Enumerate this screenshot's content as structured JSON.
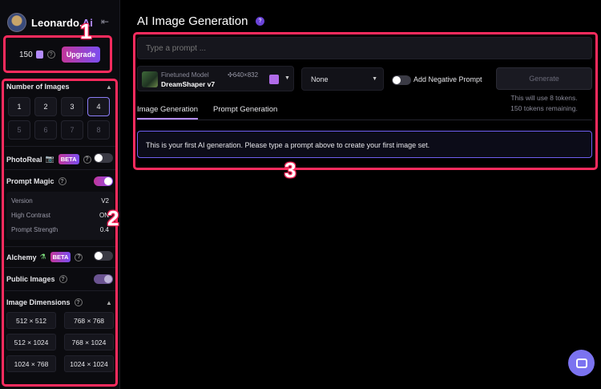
{
  "sidebar": {
    "brand_name": "Leonardo.",
    "brand_ai": "Ai",
    "collapse_icon": "collapse-icon",
    "tokens": {
      "count": "150",
      "upgrade_label": "Upgrade"
    },
    "number_of_images": {
      "label": "Number of Images",
      "options": [
        "1",
        "2",
        "3",
        "4",
        "5",
        "6",
        "7",
        "8"
      ],
      "selected": "4"
    },
    "photoreal": {
      "label": "PhotoReal",
      "badge": "BETA",
      "enabled": false
    },
    "prompt_magic": {
      "label": "Prompt Magic",
      "enabled": true,
      "version_label": "Version",
      "version_value": "V2",
      "high_contrast_label": "High Contrast",
      "high_contrast_value": "ON",
      "prompt_strength_label": "Prompt Strength",
      "prompt_strength_value": "0.4"
    },
    "alchemy": {
      "label": "Alchemy",
      "badge": "BETA",
      "enabled": false
    },
    "public_images": {
      "label": "Public Images",
      "enabled": true
    },
    "image_dimensions": {
      "label": "Image Dimensions",
      "options": [
        "512 × 512",
        "768 × 768",
        "512 × 1024",
        "768 × 1024",
        "1024 × 768",
        "1024 × 1024"
      ]
    }
  },
  "main": {
    "title": "AI Image Generation",
    "prompt_placeholder": "Type a prompt ...",
    "model": {
      "sub_label": "Finetuned Model",
      "resolution": "640×832",
      "name": "DreamShaper v7"
    },
    "style_select": "None",
    "negative_prompt_label": "Add Negative Prompt",
    "generate_label": "Generate",
    "token_note_1": "This will use 8 tokens.",
    "token_note_2": "150 tokens remaining.",
    "tabs": [
      {
        "label": "Image Generation",
        "active": true
      },
      {
        "label": "Prompt Generation",
        "active": false
      }
    ],
    "notice": "This is your first AI generation. Please type a prompt above to create your first image set."
  },
  "annotations": {
    "one": "1",
    "two": "2",
    "three": "3"
  },
  "colors": {
    "accent": "#b48cff",
    "annotation": "#ff2b5e",
    "chat": "#7b73f0"
  }
}
